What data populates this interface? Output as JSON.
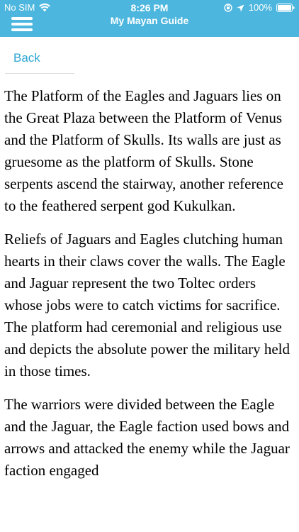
{
  "status_bar": {
    "carrier": "No SIM",
    "time": "8:26 PM",
    "battery": "100%"
  },
  "header": {
    "title": "My Mayan Guide",
    "menu_icon": "hamburger-menu-icon",
    "background_color": "#4cb6de"
  },
  "nav": {
    "back_label": "Back",
    "link_color": "#2ea5d3"
  },
  "article": {
    "paragraphs": [
      "The Platform of the Eagles and Jaguars lies on the Great Plaza between the Platform of Venus and the Platform of Skulls. Its walls are just as gruesome as the platform of Skulls. Stone serpents ascend the stairway, another reference to the feathered serpent god Kukulkan.",
      "Reliefs of Jaguars and Eagles clutching human hearts in their claws cover the walls. The Eagle and Jaguar represent the two Toltec orders whose jobs were to catch victims for sacrifice. The platform had ceremonial and religious use and depicts the absolute power the military held in those times.",
      "The warriors were divided between the Eagle and the Jaguar, the Eagle faction used bows and arrows and attacked the enemy while the Jaguar faction engaged"
    ]
  }
}
